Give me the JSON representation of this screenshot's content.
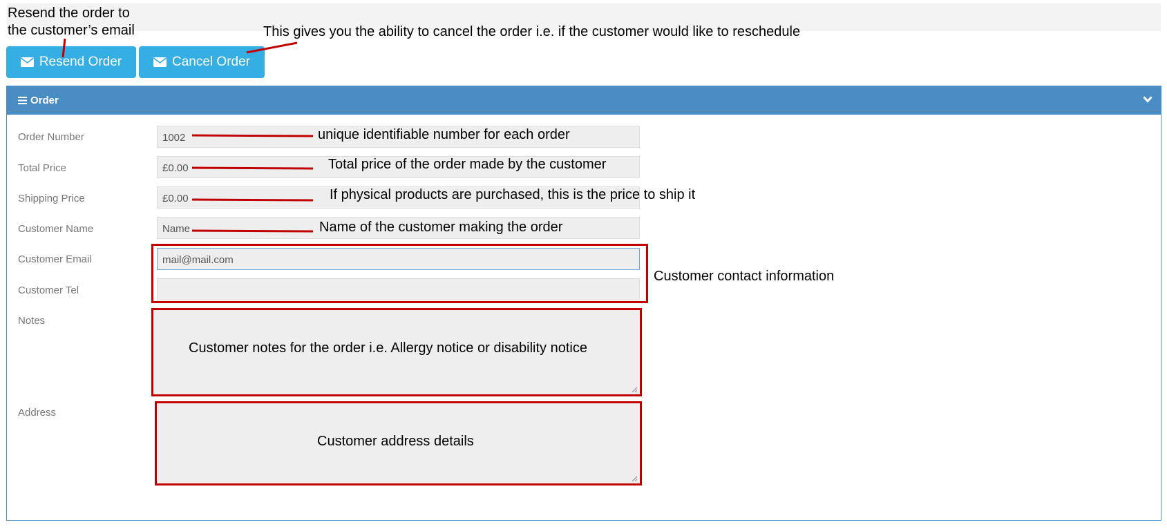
{
  "toolbar": {
    "resend_label": "Resend Order",
    "cancel_label": "Cancel Order"
  },
  "panel": {
    "title": "Order"
  },
  "fields": {
    "order_number": {
      "label": "Order Number",
      "value": "1002"
    },
    "total_price": {
      "label": "Total Price",
      "value": "£0.00"
    },
    "shipping_price": {
      "label": "Shipping Price",
      "value": "£0.00"
    },
    "customer_name": {
      "label": "Customer Name",
      "value": "Name"
    },
    "customer_email": {
      "label": "Customer Email",
      "value": "mail@mail.com"
    },
    "customer_tel": {
      "label": "Customer Tel",
      "value": ""
    },
    "notes": {
      "label": "Notes",
      "value": ""
    },
    "address": {
      "label": "Address",
      "value": ""
    }
  },
  "annotations": {
    "resend_line1": "Resend the order to",
    "resend_line2": "the customer’s email",
    "cancel": "This gives you the ability to cancel the order i.e. if the customer would like to reschedule",
    "order_number": "unique identifiable number for each order",
    "total_price": "Total price of the order made by the customer",
    "shipping_price": "If physical products are purchased, this is the price to ship it",
    "customer_name": "Name of the customer making the order",
    "contact": "Customer contact information",
    "notes": "Customer notes for the order i.e. Allergy notice or disability notice",
    "address": "Customer address details"
  },
  "icons": {
    "resend": "envelope-icon",
    "cancel": "envelope-icon",
    "panel": "list-icon",
    "collapse": "chevron-down-icon"
  },
  "colors": {
    "button": "#35aee4",
    "panel_header": "#4a8dc5",
    "annotation": "#c10000"
  }
}
